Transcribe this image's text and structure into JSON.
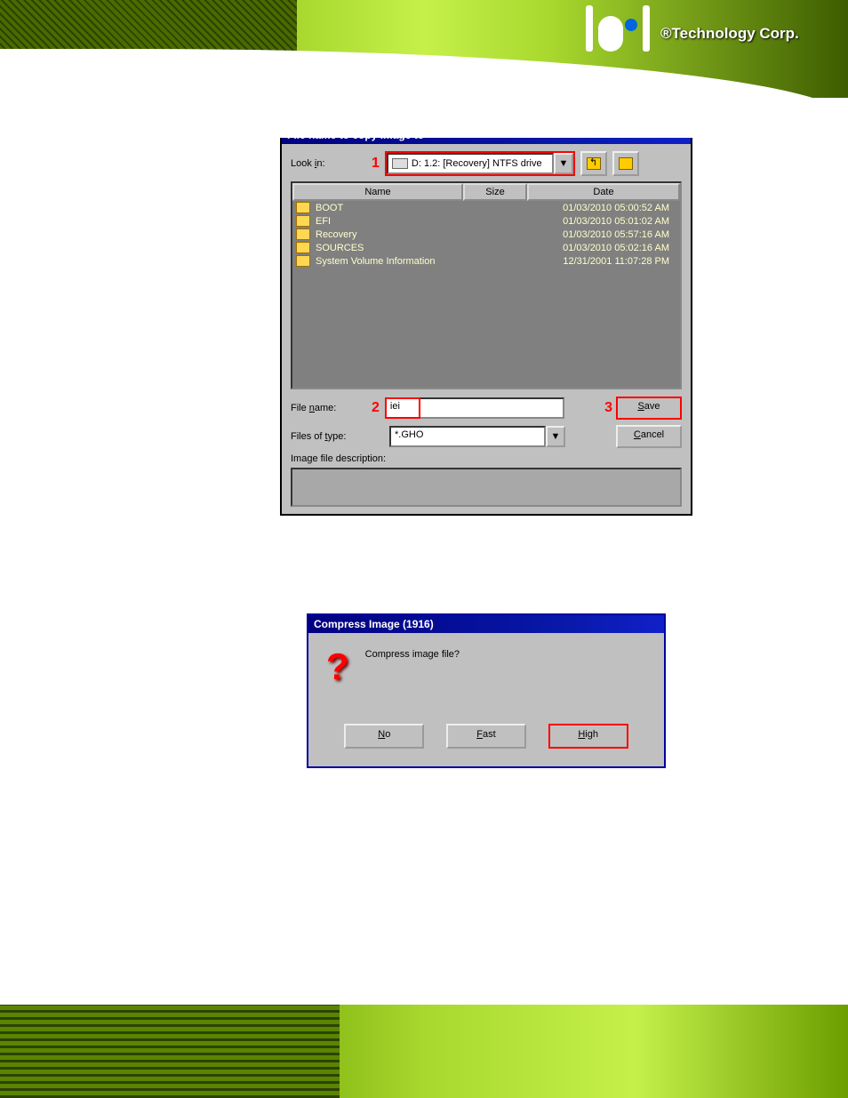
{
  "header": {
    "tagline": "®Technology Corp."
  },
  "dialog1": {
    "title": "File name to copy image to",
    "lookin_label": "Look in:",
    "drive": "D: 1.2: [Recovery] NTFS drive",
    "marker1": "1",
    "marker2": "2",
    "marker3": "3",
    "headers": {
      "name": "Name",
      "size": "Size",
      "date": "Date"
    },
    "files": [
      {
        "name": "BOOT",
        "date": "01/03/2010 05:00:52 AM"
      },
      {
        "name": "EFI",
        "date": "01/03/2010 05:01:02 AM"
      },
      {
        "name": "Recovery",
        "date": "01/03/2010 05:57:16 AM"
      },
      {
        "name": "SOURCES",
        "date": "01/03/2010 05:02:16 AM"
      },
      {
        "name": "System Volume Information",
        "date": "12/31/2001 11:07:28 PM"
      }
    ],
    "filename_label": "File name:",
    "filename_value": "iei",
    "filetype_label": "Files of type:",
    "filetype_value": "*.GHO",
    "desc_label": "Image file description:",
    "save_btn": "Save",
    "cancel_btn": "Cancel"
  },
  "dialog2": {
    "title": "Compress Image (1916)",
    "message": "Compress image file?",
    "no_btn": "No",
    "fast_btn": "Fast",
    "high_btn": "High"
  }
}
